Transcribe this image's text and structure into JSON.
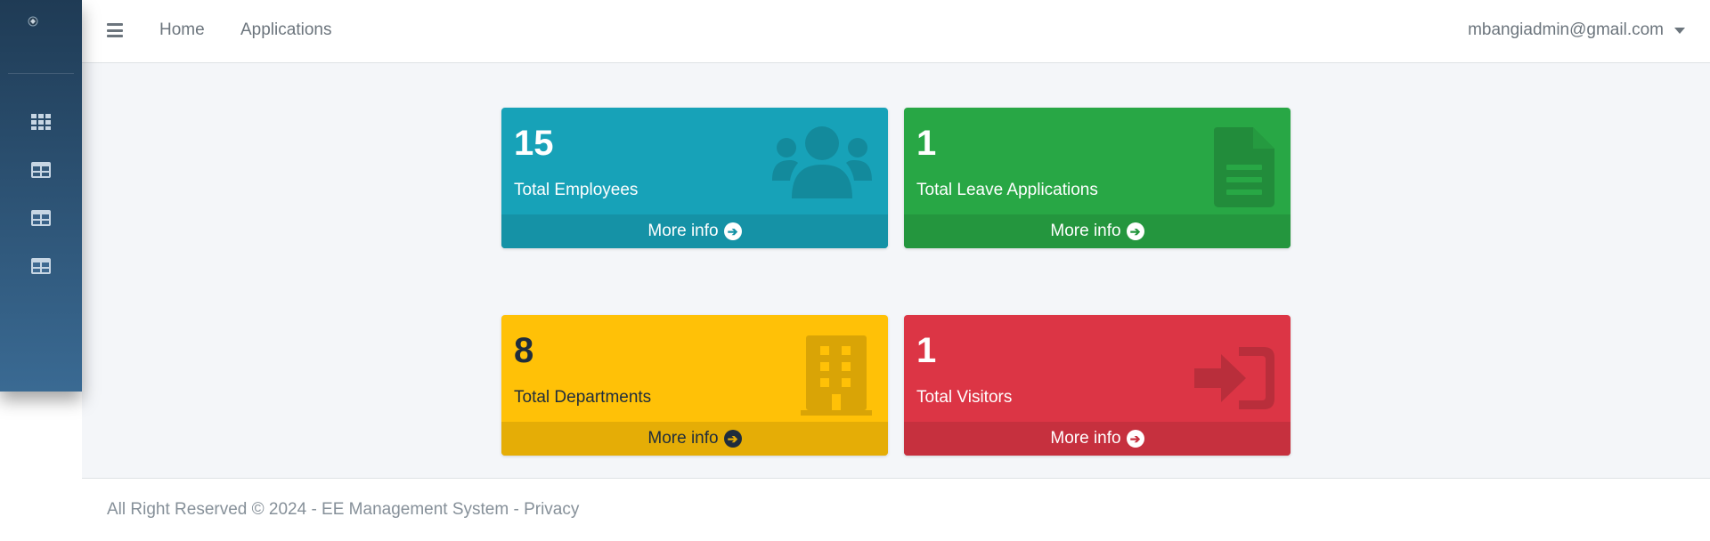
{
  "topbar": {
    "nav": [
      "Home",
      "Applications"
    ],
    "user_email": "mbangiadmin@gmail.com"
  },
  "sidebar": {
    "icons": [
      "grid-icon",
      "table-icon",
      "table-icon",
      "table-icon"
    ]
  },
  "cards": [
    {
      "value": "15",
      "label": "Total Employees",
      "link": "More info",
      "icon": "users-icon",
      "color": "#17a2b8"
    },
    {
      "value": "1",
      "label": "Total Leave Applications",
      "link": "More info",
      "icon": "file-icon",
      "color": "#28a745"
    },
    {
      "value": "8",
      "label": "Total Departments",
      "link": "More info",
      "icon": "building-icon",
      "color": "#ffc107"
    },
    {
      "value": "1",
      "label": "Total Visitors",
      "link": "More info",
      "icon": "sign-in-icon",
      "color": "#dc3545"
    }
  ],
  "footer": {
    "text": "All Right Reserved © 2024 - EE Management System - Privacy"
  }
}
